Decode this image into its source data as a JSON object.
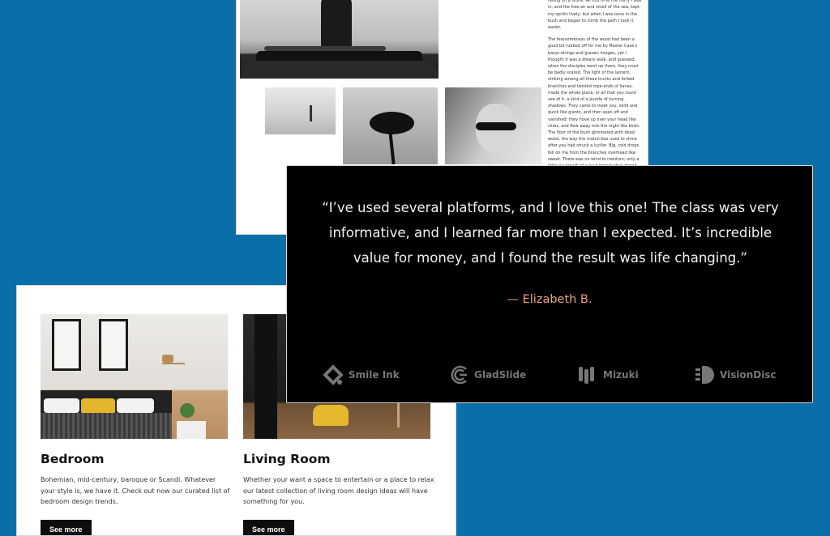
{
  "article": {
    "paragraphs": [
      "wash caught me in the knees, and I came near falling on a stone. All this time the hurry I was in, and the free air and smell of the sea, kept my spirits lively; but when I was once in the bush and began to climb the path I took it easier.",
      "The fearsomeness of the wood had been a good bit rubbed off for me by Master Case's banjo-strings and graven images, yet I thought it was a dreary walk, and guessed, when the disciples went up there, they must be badly scared. The light of the lantern, striking among all these trunks and forked branches and twisted rope-ends of lianas, made the whole place, or all that you could see of it, a kind of a puzzle of turning shadows. They came to meet you, solid and quick like giants, and then span off and vanished; they hove up over your head like clubs, and flew away into the night like birds. The floor of the bush glimmered with dead wood, the way the match-box used to shine after you had struck a lucifer. Big, cold drops fell on me from the branches overhead like sweat. There was no wind to mention; only a little icy breath of a land-breeze that stirred nothing; and the harps were silent."
    ]
  },
  "rooms": [
    {
      "title": "Bedroom",
      "description": "Bohemian, mid-century, baroque or Scandi. Whatever your style is, we have it. Check out now our curated list of bedroom design trends.",
      "button": "See more"
    },
    {
      "title": "Living Room",
      "description": "Whether your want a space to entertain or a place to relax our latest collection of living room design ideas will have something for you.",
      "button": "See more"
    }
  ],
  "testimonial": {
    "quote": "“I’ve used several platforms, and I love this one! The class was very informative, and I learned far more than I expected. It’s incredible value for money, and I found the result was life changing.”",
    "author": "— Elizabeth B.",
    "logos": [
      {
        "name": "Smile Ink",
        "icon": "smile-ink-logo-icon"
      },
      {
        "name": "GladSlide",
        "icon": "gladslide-logo-icon"
      },
      {
        "name": "Mizuki",
        "icon": "mizuki-logo-icon"
      },
      {
        "name": "VisionDisc",
        "icon": "visiondisc-logo-icon"
      }
    ]
  },
  "colors": {
    "background": "#0a6fa8",
    "testimonial_bg": "#000000",
    "author_accent": "#e4a383",
    "button_bg": "#0d0d0d"
  }
}
